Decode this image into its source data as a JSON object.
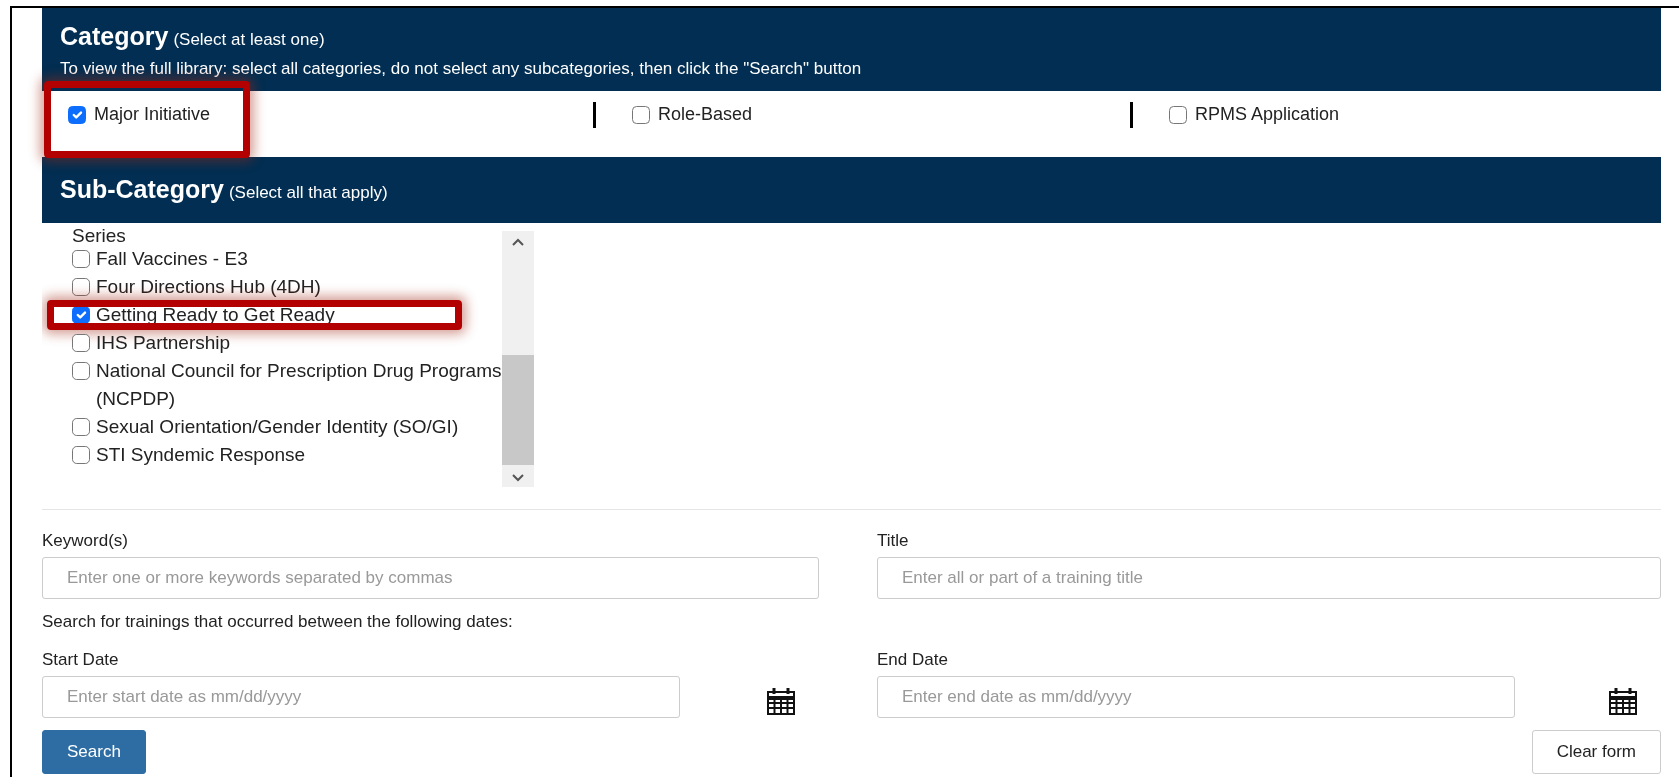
{
  "category": {
    "title": "Category",
    "hint": "(Select at least one)",
    "instructions": "To view the full library: select all categories, do not select any subcategories, then click the \"Search\" button",
    "options": [
      {
        "label": "Major Initiative",
        "checked": true,
        "highlighted": true
      },
      {
        "label": "Role-Based",
        "checked": false,
        "highlighted": false
      },
      {
        "label": "RPMS Application",
        "checked": false,
        "highlighted": false
      }
    ]
  },
  "sub_category": {
    "title": "Sub-Category",
    "hint": "(Select all that apply)",
    "items": [
      {
        "kind": "continuation",
        "label": "Series"
      },
      {
        "kind": "checkbox",
        "label": "Fall Vaccines - E3",
        "checked": false,
        "highlighted": false
      },
      {
        "kind": "checkbox",
        "label": "Four Directions Hub (4DH)",
        "checked": false,
        "highlighted": false
      },
      {
        "kind": "checkbox",
        "label": "Getting Ready to Get Ready",
        "checked": true,
        "highlighted": true
      },
      {
        "kind": "checkbox",
        "label": "IHS Partnership",
        "checked": false,
        "highlighted": false
      },
      {
        "kind": "checkbox",
        "label": "National Council for Prescription Drug Programs (NCPDP)",
        "checked": false,
        "highlighted": false
      },
      {
        "kind": "checkbox",
        "label": "Sexual Orientation/Gender Identity (SO/GI)",
        "checked": false,
        "highlighted": false
      },
      {
        "kind": "checkbox",
        "label": "STI Syndemic Response",
        "checked": false,
        "highlighted": false
      }
    ]
  },
  "keywords": {
    "label": "Keyword(s)",
    "placeholder": "Enter one or more keywords separated by commas"
  },
  "title_field": {
    "label": "Title",
    "placeholder": "Enter all or part of a training title"
  },
  "dates_note": "Search for trainings that occurred between the following dates:",
  "start_date": {
    "label": "Start Date",
    "placeholder": "Enter start date as mm/dd/yyyy"
  },
  "end_date": {
    "label": "End Date",
    "placeholder": "Enter end date as mm/dd/yyyy"
  },
  "buttons": {
    "search": "Search",
    "clear": "Clear form"
  }
}
